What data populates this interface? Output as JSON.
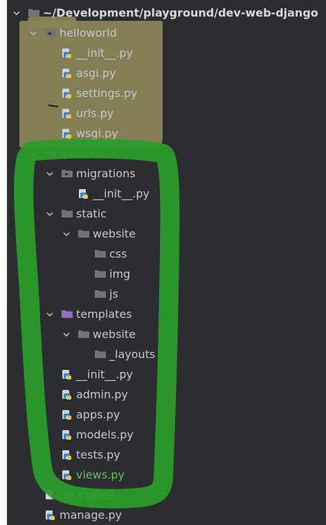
{
  "colors": {
    "panel_bg": "#2b2d30",
    "text": "#c5c8ce",
    "folder": "#6f737a",
    "templates_folder": "#8f6fc7",
    "highlight_olive": "#8b8558",
    "annotation_green": "#2a9d2a",
    "changed_file_green": "#62c554"
  },
  "tree": [
    {
      "label": "~/Development/playground/dev-web-django",
      "icon": "folder-icon",
      "chevron": "chevron-down-icon",
      "depth": 0,
      "bold": true
    },
    {
      "label": "helloworld",
      "icon": "package-folder-icon",
      "chevron": "chevron-down-icon",
      "depth": 1
    },
    {
      "label": "__init__.py",
      "icon": "python-file-icon",
      "depth": 2
    },
    {
      "label": "asgi.py",
      "icon": "python-file-icon",
      "depth": 2
    },
    {
      "label": "settings.py",
      "icon": "python-file-icon",
      "depth": 2
    },
    {
      "label": "urls.py",
      "icon": "python-file-icon",
      "depth": 2
    },
    {
      "label": "wsgi.py",
      "icon": "python-file-icon",
      "depth": 2
    },
    {
      "label": "website",
      "icon": "package-folder-icon",
      "chevron": "chevron-down-icon",
      "depth": 1,
      "color": "#62c554"
    },
    {
      "label": "migrations",
      "icon": "package-folder-icon",
      "chevron": "chevron-down-icon",
      "depth": 2
    },
    {
      "label": "__init__.py",
      "icon": "python-file-icon",
      "depth": 3
    },
    {
      "label": "static",
      "icon": "folder-icon",
      "chevron": "chevron-down-icon",
      "depth": 2
    },
    {
      "label": "website",
      "icon": "folder-icon",
      "chevron": "chevron-down-icon",
      "depth": 3
    },
    {
      "label": "css",
      "icon": "folder-icon",
      "depth": 4
    },
    {
      "label": "img",
      "icon": "folder-icon",
      "depth": 4
    },
    {
      "label": "js",
      "icon": "folder-icon",
      "depth": 4
    },
    {
      "label": "templates",
      "icon": "templates-folder-icon",
      "chevron": "chevron-down-icon",
      "depth": 2
    },
    {
      "label": "website",
      "icon": "folder-icon",
      "chevron": "chevron-down-icon",
      "depth": 3
    },
    {
      "label": "_layouts",
      "icon": "folder-icon",
      "depth": 4
    },
    {
      "label": "__init__.py",
      "icon": "python-file-icon",
      "depth": 2
    },
    {
      "label": "admin.py",
      "icon": "python-file-icon",
      "depth": 2
    },
    {
      "label": "apps.py",
      "icon": "python-file-icon",
      "depth": 2
    },
    {
      "label": "models.py",
      "icon": "python-file-icon",
      "depth": 2
    },
    {
      "label": "tests.py",
      "icon": "python-file-icon",
      "depth": 2
    },
    {
      "label": "views.py",
      "icon": "python-file-icon",
      "depth": 2,
      "color": "#62c554"
    },
    {
      "label": "db.sqlite3",
      "icon": "unknown-file-icon",
      "depth": 1
    },
    {
      "label": "manage.py",
      "icon": "python-file-icon",
      "depth": 1
    }
  ]
}
